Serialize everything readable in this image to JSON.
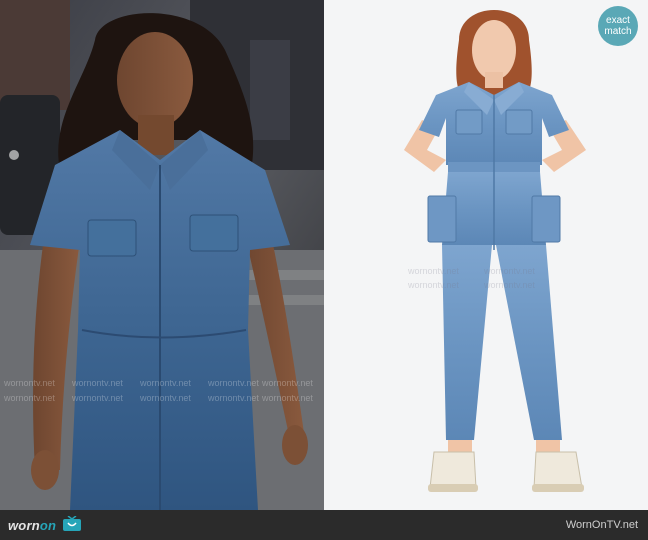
{
  "left_photo": {
    "alt_label": ""
  },
  "right_photo": {
    "badge": {
      "line1": "exact",
      "line2": "match"
    }
  },
  "watermark_text": "wornontv.net",
  "footer": {
    "brand_prefix": "worn",
    "brand_suffix": "on",
    "site_url": "WornOnTV.net"
  },
  "colors": {
    "badge": "#5aa8b6",
    "footer_bg": "#2b2b2b",
    "brand_accent": "#26a5b8"
  }
}
